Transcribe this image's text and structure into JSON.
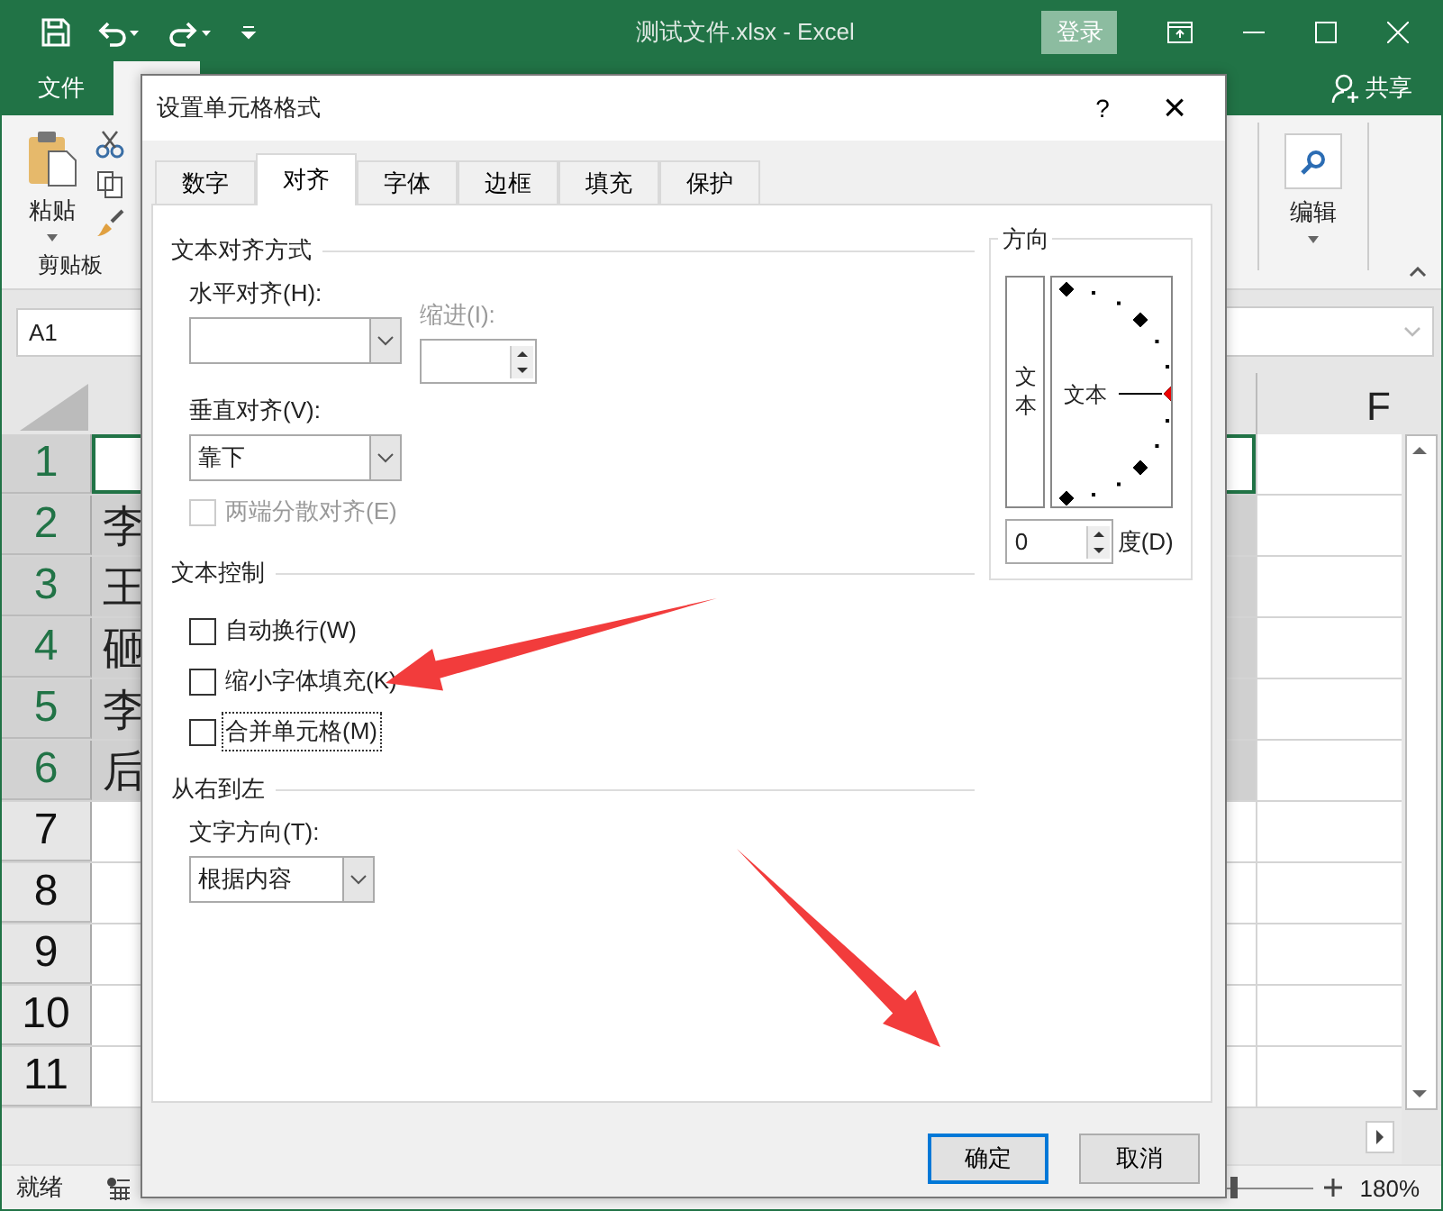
{
  "window": {
    "title": "测试文件.xlsx  -  Excel",
    "login": "登录"
  },
  "ribbon": {
    "tabs": [
      {
        "label": "文件",
        "selected": false
      },
      {
        "selected": true
      }
    ],
    "share": "共享",
    "paste": "粘贴",
    "clipboard_group": "剪贴板",
    "editing": "编辑"
  },
  "name_box": "A1",
  "sheet": {
    "column_header": "F",
    "rows": [
      {
        "number": "1",
        "selected": true
      },
      {
        "number": "2",
        "selected": true,
        "cell": "李"
      },
      {
        "number": "3",
        "selected": true,
        "cell": "王"
      },
      {
        "number": "4",
        "selected": true,
        "cell": "砸"
      },
      {
        "number": "5",
        "selected": true,
        "cell": "李"
      },
      {
        "number": "6",
        "selected": true,
        "cell": "后"
      },
      {
        "number": "7",
        "selected": false
      },
      {
        "number": "8",
        "selected": false
      },
      {
        "number": "9",
        "selected": false
      },
      {
        "number": "10",
        "selected": false
      },
      {
        "number": "11",
        "selected": false
      }
    ]
  },
  "status_bar": {
    "status": "就绪",
    "zoom": "180%",
    "zoom_slider": {
      "level": 0.2
    }
  },
  "dialog": {
    "title": "设置单元格格式",
    "help": "?",
    "close": "×",
    "tabs": [
      {
        "label": "数字",
        "selected": false
      },
      {
        "label": "对齐",
        "selected": true
      },
      {
        "label": "字体",
        "selected": false
      },
      {
        "label": "边框",
        "selected": false
      },
      {
        "label": "填充",
        "selected": false
      },
      {
        "label": "保护",
        "selected": false
      }
    ],
    "alignment": {
      "section": "文本对齐方式",
      "horizontal_label": "水平对齐(H):",
      "indent": {
        "label": "缩进(I):",
        "disabled": true
      },
      "vertical_label": "垂直对齐(V):",
      "vertical_value": "靠下",
      "distributed": {
        "label": "两端分散对齐(E)",
        "checked": false,
        "disabled": true
      }
    },
    "text_control": {
      "section": "文本控制",
      "options": [
        {
          "label": "自动换行(W)",
          "checked": false,
          "focused": false
        },
        {
          "label": "缩小字体填充(K)",
          "checked": false,
          "focused": false
        },
        {
          "label": "合并单元格(M)",
          "checked": false,
          "focused": true
        }
      ]
    },
    "rtl": {
      "section": "从右到左",
      "direction_label": "文字方向(T):",
      "direction_value": "根据内容"
    },
    "orientation": {
      "section": "方向",
      "vertical_text": "文本",
      "dial_text": "文本",
      "degrees": "0",
      "degrees_label": "度(D)"
    },
    "buttons": [
      {
        "label": "确定",
        "default": true
      },
      {
        "label": "取消",
        "default": false
      }
    ]
  }
}
